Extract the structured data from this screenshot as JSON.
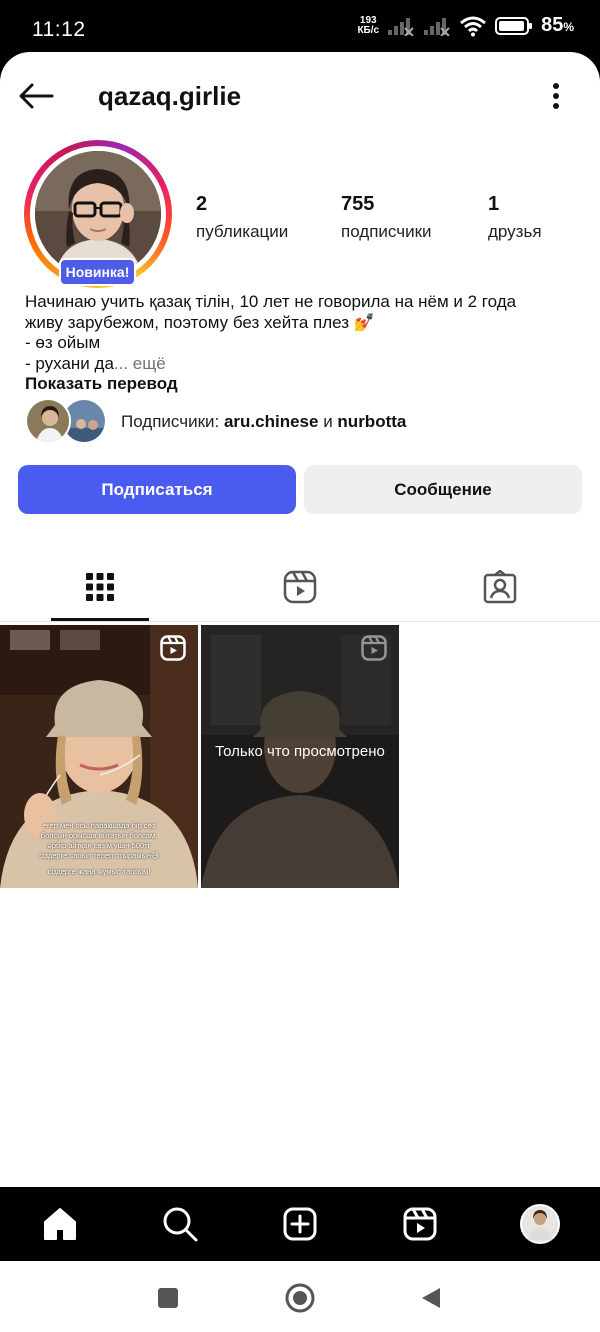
{
  "status_bar": {
    "time": "11:12",
    "speed_value": "193",
    "speed_unit": "КБ/с",
    "battery_percent": "85",
    "battery_symbol": "%"
  },
  "header": {
    "username": "qazaq.girlie",
    "back_icon": "arrow-left-icon",
    "more_icon": "vertical-dots-icon"
  },
  "profile": {
    "new_badge": "Новинка!",
    "stats": [
      {
        "value": "2",
        "label": "публикации"
      },
      {
        "value": "755",
        "label": "подписчики"
      },
      {
        "value": "1",
        "label": "друзья"
      }
    ],
    "bio_line1": "Начинаю учить қазақ тілін, 10 лет не говорила на нём и 2 года",
    "bio_line2": "живу зарубежом, поэтому без хейта плез 💅",
    "bio_line3": "- өз ойым",
    "bio_line4": "- рухани да",
    "bio_more": "... ещё",
    "show_translation": "Показать перевод",
    "followers_prefix": "Подписчики: ",
    "follower1": "aru.chinese",
    "followers_and": " и ",
    "follower2": "nurbotta"
  },
  "buttons": {
    "follow": "Подписаться",
    "message": "Сообщение"
  },
  "tabs": [
    {
      "icon": "grid-icon",
      "active": true
    },
    {
      "icon": "reels-icon",
      "active": false
    },
    {
      "icon": "tagged-icon",
      "active": false
    }
  ],
  "posts": [
    {
      "caption_line1": "егер мен осы парақшада бір сөз",
      "caption_line2": "болсын орысша айтатын болсам,",
      "caption_line3": "әрбір айтқан сөзім үшін 500тг",
      "caption_line4": "сіздерге салып телеп отырамын😅",
      "caption_line5": "сіздерге жаңа жұмыс таптым!"
    },
    {
      "seen_label": "Только что просмотрено"
    }
  ],
  "bottom_nav": [
    "home-icon",
    "search-icon",
    "create-icon",
    "reels-icon",
    "profile-avatar"
  ],
  "colors": {
    "accent": "#4a5cf0",
    "badge": "#4e5ce8",
    "secondary_button": "#efefef"
  }
}
